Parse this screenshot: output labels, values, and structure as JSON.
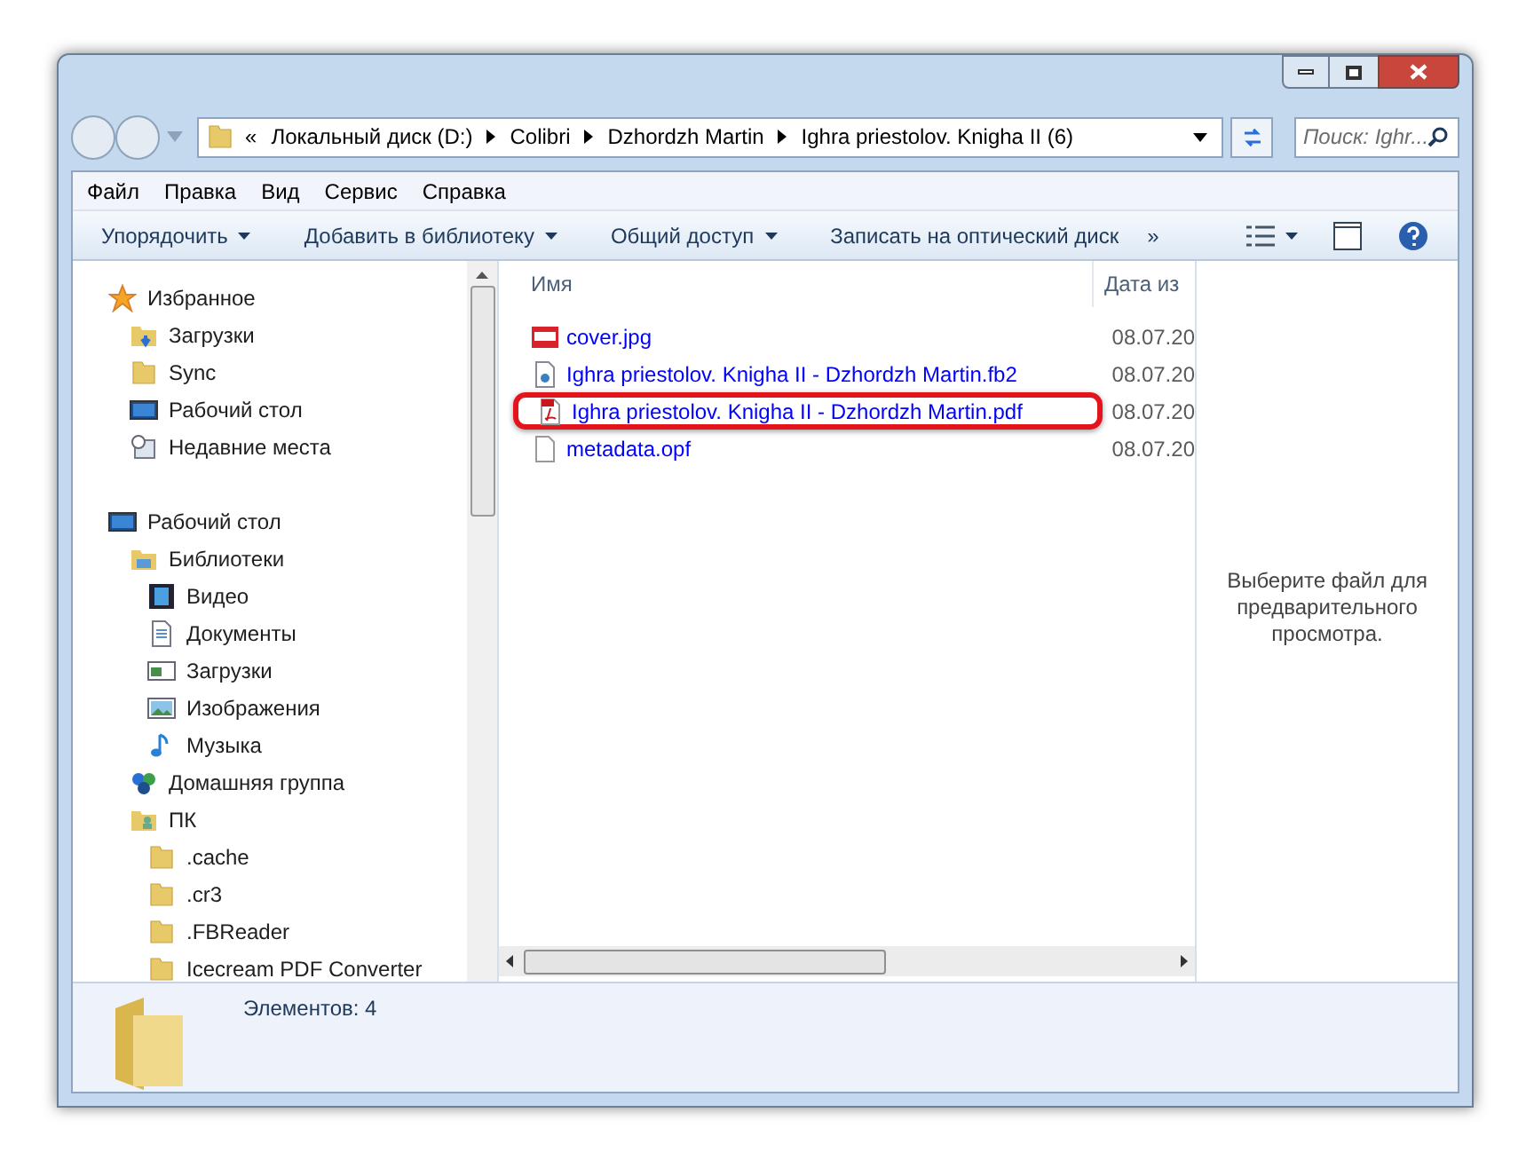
{
  "address_bar": {
    "overflow": "«",
    "segments": [
      "Локальный диск (D:)",
      "Colibri",
      "Dzhordzh Martin",
      "Ighra priestolov. Knigha II (6)"
    ]
  },
  "search": {
    "placeholder": "Поиск: Ighr..."
  },
  "menu": [
    "Файл",
    "Правка",
    "Вид",
    "Сервис",
    "Справка"
  ],
  "toolbar": [
    "Упорядочить",
    "Добавить в библиотеку",
    "Общий доступ",
    "Записать на оптический диск"
  ],
  "toolbar_more": "»",
  "navigation": [
    {
      "label": "Избранное",
      "kind": "star",
      "children": [
        {
          "label": "Загрузки",
          "kind": "downloads"
        },
        {
          "label": "Sync",
          "kind": "folder"
        },
        {
          "label": "Рабочий стол",
          "kind": "desktop"
        },
        {
          "label": "Недавние места",
          "kind": "recent"
        }
      ]
    },
    {
      "label": "Рабочий стол",
      "kind": "desktop",
      "children": [
        {
          "label": "Библиотеки",
          "kind": "library",
          "children": [
            {
              "label": "Видео",
              "kind": "video"
            },
            {
              "label": "Документы",
              "kind": "document"
            },
            {
              "label": "Загрузки",
              "kind": "window"
            },
            {
              "label": "Изображения",
              "kind": "image"
            },
            {
              "label": "Музыка",
              "kind": "music"
            }
          ]
        },
        {
          "label": "Домашняя группа",
          "kind": "homegroup"
        },
        {
          "label": "ПК",
          "kind": "pc",
          "children": [
            {
              "label": ".cache",
              "kind": "folder"
            },
            {
              "label": ".cr3",
              "kind": "folder"
            },
            {
              "label": ".FBReader",
              "kind": "folder"
            },
            {
              "label": "Icecream PDF Converter",
              "kind": "folder"
            }
          ]
        }
      ]
    }
  ],
  "columns": [
    "Имя",
    "Дата из"
  ],
  "files": [
    {
      "name": "cover.jpg",
      "date": "08.07.20",
      "kind": "jpg",
      "annotated": false
    },
    {
      "name": "Ighra priestolov. Knigha II - Dzhordzh Martin.fb2",
      "date": "08.07.20",
      "kind": "fb2",
      "annotated": false
    },
    {
      "name": "Ighra priestolov. Knigha II - Dzhordzh Martin.pdf",
      "date": "08.07.20",
      "kind": "pdf",
      "annotated": true
    },
    {
      "name": "metadata.opf",
      "date": "08.07.20",
      "kind": "opf",
      "annotated": false
    }
  ],
  "preview_message": "Выберите файл для предварительного просмотра.",
  "status_bar": {
    "item_count": "Элементов: 4"
  }
}
